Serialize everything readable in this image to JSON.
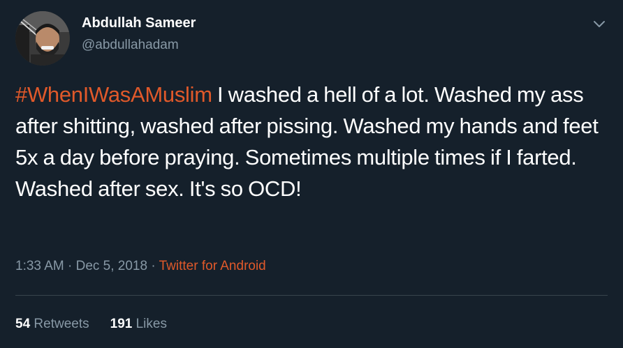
{
  "user": {
    "display_name": "Abdullah Sameer",
    "handle": "@abdullahadam"
  },
  "tweet": {
    "hashtag": "#WhenIWasAMuslim",
    "text": " I washed a hell of a lot. Washed my ass after shitting, washed after pissing. Washed my hands and feet 5x a day before praying. Sometimes multiple times if I farted. Washed after sex. It's so OCD!",
    "time": "1:33 AM",
    "date": "Dec 5, 2018",
    "separator": " · ",
    "source": "Twitter for Android"
  },
  "stats": {
    "retweets_count": "54",
    "retweets_label": "Retweets",
    "likes_count": "191",
    "likes_label": "Likes"
  },
  "colors": {
    "background": "#15202b",
    "accent": "#e0592a",
    "secondary_text": "#8899a6",
    "divider": "#38444d"
  },
  "icons": {
    "menu": "chevron-down-icon"
  }
}
